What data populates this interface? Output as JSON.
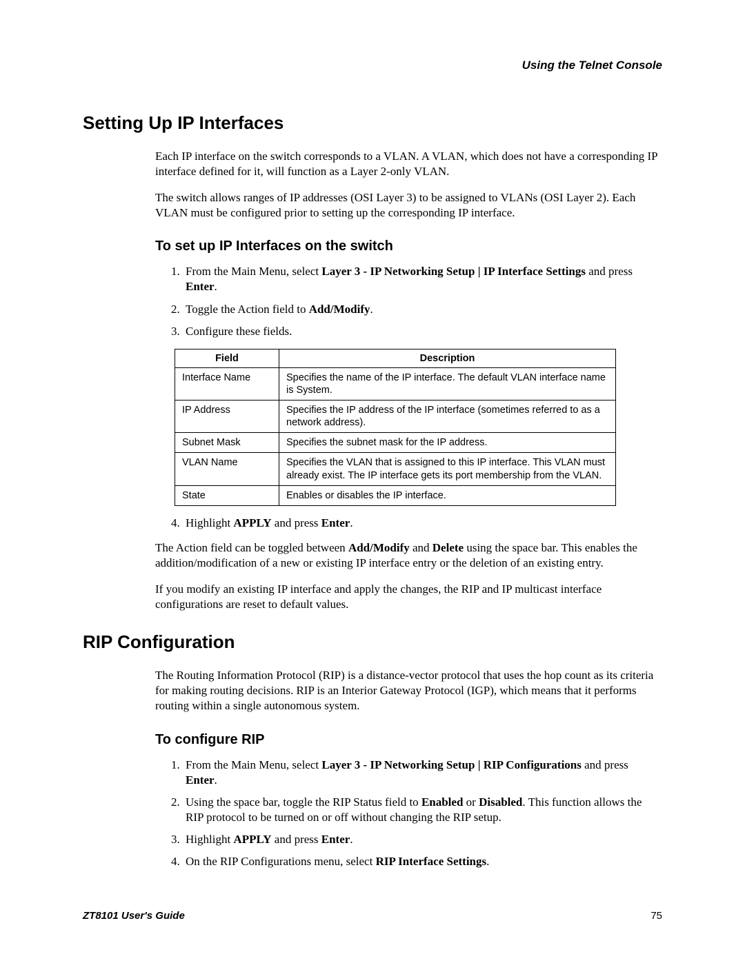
{
  "chapterHeader": "Using the Telnet Console",
  "section1": {
    "title": "Setting Up IP Interfaces",
    "para1": "Each IP interface on the switch corresponds to a VLAN. A VLAN, which does not have a corresponding IP interface defined for it, will function as a Layer 2-only VLAN.",
    "para2": "The switch allows ranges of IP addresses (OSI Layer 3) to be assigned to VLANs (OSI Layer 2). Each VLAN must be configured prior to setting up the corresponding IP interface.",
    "subTitle": "To set up IP Interfaces on the switch",
    "step1_a": "From the Main Menu, select ",
    "step1_b": "Layer 3 - IP Networking Setup | IP Interface Settings",
    "step1_c": " and press ",
    "step1_d": "Enter",
    "step1_e": ".",
    "step2_a": "Toggle the Action field to ",
    "step2_b": "Add/Modify",
    "step2_c": ".",
    "step3": "Configure these fields.",
    "tableHeaders": {
      "field": "Field",
      "desc": "Description"
    },
    "rows": [
      {
        "f": "Interface Name",
        "d": "Specifies the name of the IP interface. The default VLAN interface name is System."
      },
      {
        "f": "IP Address",
        "d": "Specifies the IP address of the IP interface (sometimes referred to as a network address)."
      },
      {
        "f": "Subnet Mask",
        "d": "Specifies the subnet mask for the IP address."
      },
      {
        "f": "VLAN Name",
        "d": "Specifies the VLAN that is assigned to this IP interface. This VLAN must already exist. The IP interface gets its port membership from the VLAN."
      },
      {
        "f": "State",
        "d": "Enables or disables the IP interface."
      }
    ],
    "step4_a": "Highlight ",
    "step4_b": "APPLY",
    "step4_c": " and press ",
    "step4_d": "Enter",
    "step4_e": ".",
    "para3_a": "The Action field can be toggled between ",
    "para3_b": "Add/Modify",
    "para3_c": " and ",
    "para3_d": "Delete",
    "para3_e": " using the space bar. This enables the addition/modification of a new or existing IP interface entry or the deletion of an existing entry.",
    "para4": "If you modify an existing IP interface and apply the changes, the RIP and IP multicast interface configurations are reset to default values."
  },
  "section2": {
    "title": "RIP Configuration",
    "para1": "The Routing Information Protocol (RIP) is a distance-vector protocol that uses the hop count as its criteria for making routing decisions. RIP is an Interior Gateway Protocol (IGP), which means that it performs routing within a single autonomous system.",
    "subTitle": "To configure RIP",
    "step1_a": "From the Main Menu, select ",
    "step1_b": "Layer 3 - IP Networking Setup | RIP Configurations",
    "step1_c": " and press ",
    "step1_d": "Enter",
    "step1_e": ".",
    "step2_a": "Using the space bar, toggle the RIP Status field to ",
    "step2_b": "Enabled",
    "step2_c": " or ",
    "step2_d": "Disabled",
    "step2_e": ". This function allows the RIP protocol to be turned on or off without changing the RIP setup.",
    "step3_a": "Highlight ",
    "step3_b": "APPLY",
    "step3_c": " and press ",
    "step3_d": "Enter",
    "step3_e": ".",
    "step4_a": "On the RIP Configurations menu, select ",
    "step4_b": "RIP Interface Settings",
    "step4_c": "."
  },
  "footer": {
    "guide": "ZT8101 User's Guide",
    "page": "75"
  }
}
